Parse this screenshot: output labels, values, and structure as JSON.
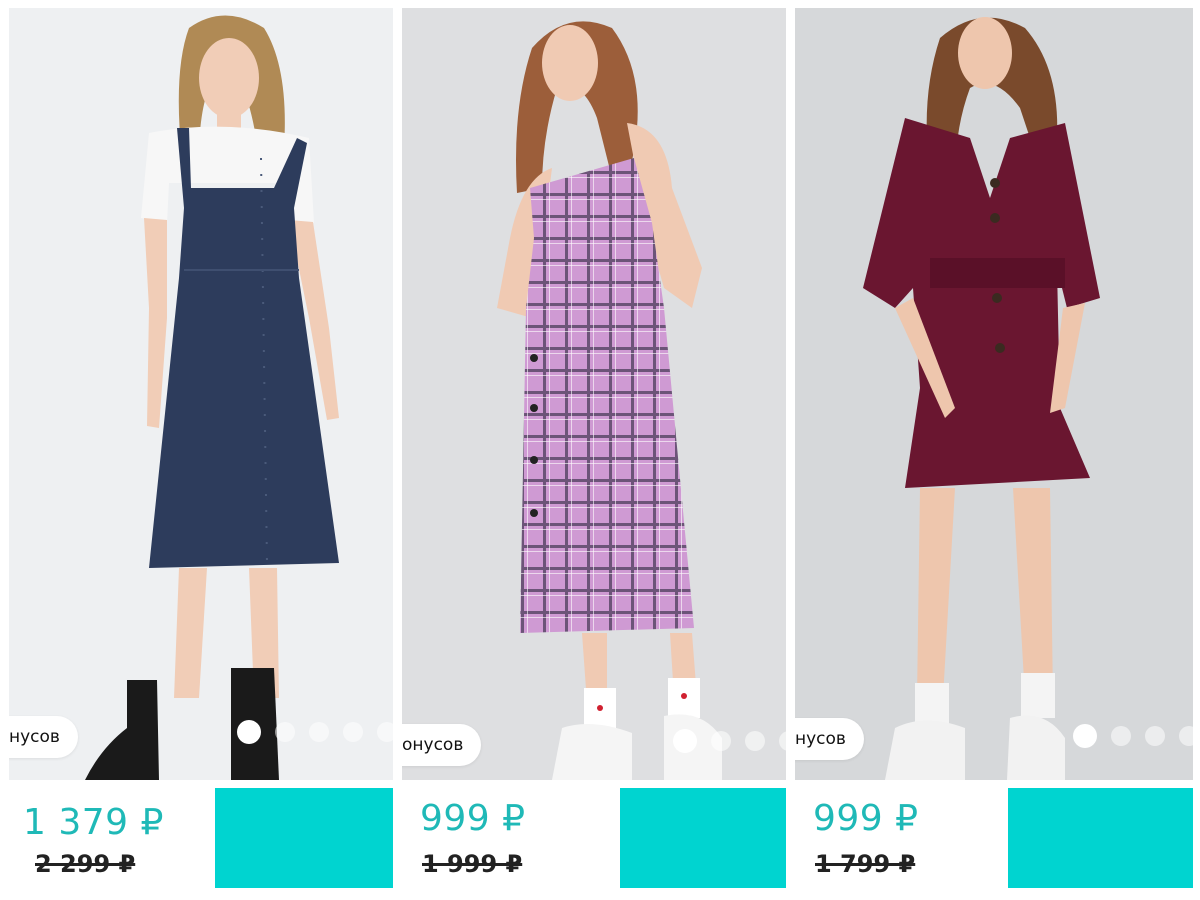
{
  "products": [
    {
      "photo_name": "denim-pinafore-dress-photo",
      "bonus_text": "нусов",
      "price": "1 379 ₽",
      "old_price": "2 299 ₽",
      "slides": 5,
      "active_slide": 1,
      "colors": {
        "background": "#eef0f2",
        "garment": "#2d3c5c",
        "accent": "#1fb9b7",
        "button": "#00d4d0"
      }
    },
    {
      "photo_name": "pink-plaid-dress-photo",
      "bonus_text": "онусов",
      "price": "999 ₽",
      "old_price": "1 999 ₽",
      "slides": 4,
      "active_slide": 1,
      "colors": {
        "background": "#dedfe1",
        "garment": "#cf9ad3",
        "accent": "#1fb9b7",
        "button": "#00d4d0"
      }
    },
    {
      "photo_name": "burgundy-shirt-dress-photo",
      "bonus_text": "нусов",
      "price": "999 ₽",
      "old_price": "1 799 ₽",
      "slides": 5,
      "active_slide": 1,
      "colors": {
        "background": "#d6d8da",
        "garment": "#6a1630",
        "accent": "#1fb9b7",
        "button": "#00d4d0"
      }
    }
  ]
}
